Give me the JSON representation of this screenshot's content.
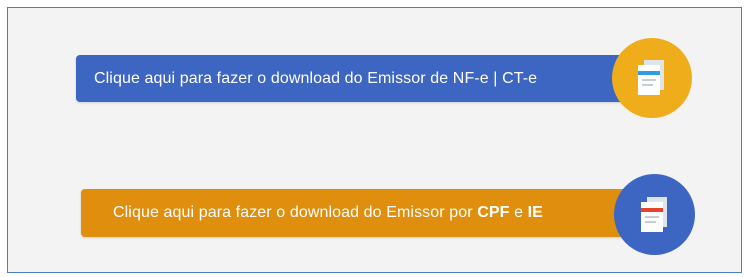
{
  "nfe_download": {
    "label": "Clique aqui para fazer o download do Emissor de NF-e | CT-e",
    "color": "#3d65c2",
    "icon": "document-icon",
    "icon_circle_color": "#f0ad1b"
  },
  "cpf_download": {
    "label_prefix": "Clique aqui para fazer o download do Emissor por ",
    "label_bold_1": "CPF",
    "label_mid": " e ",
    "label_bold_2": "IE",
    "color": "#df8e0d",
    "icon": "document-icon",
    "icon_circle_color": "#3d65c2"
  },
  "panel_border_color": "#4a7cc9",
  "background_color": "#f3f3f3"
}
